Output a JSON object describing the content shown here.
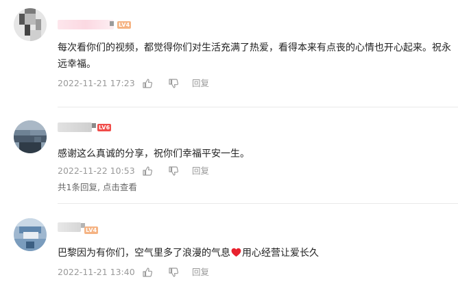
{
  "comments": [
    {
      "text": "每次看你们的视频，都觉得你们对生活充满了热爱，看得本来有点丧的心情也开心起来。祝永远幸福。",
      "time": "2022-11-21 17:23",
      "reply_label": "回复",
      "level_badge": "LV4",
      "level_color": "#f5b383"
    },
    {
      "text_before": "感谢这么真诚的分享，祝你们幸福平安一生。",
      "time": "2022-11-22 10:53",
      "reply_label": "回复",
      "level_badge": "LV6",
      "level_color": "#f04c49",
      "replies_count": "共1条回复",
      "replies_action": "点击查看"
    },
    {
      "text_before": "巴黎因为有你们，空气里多了浪漫的气息",
      "text_after": "用心经营让爱长久",
      "time": "2022-11-21 13:40",
      "reply_label": "回复",
      "level_badge": "LV4",
      "level_color": "#f5b383",
      "emoji": "heart-emoji"
    }
  ],
  "colors": {
    "text": "#222222",
    "meta": "#999999",
    "link": "#666666",
    "divider": "#e9e9e9",
    "heart": "#e8222e"
  }
}
